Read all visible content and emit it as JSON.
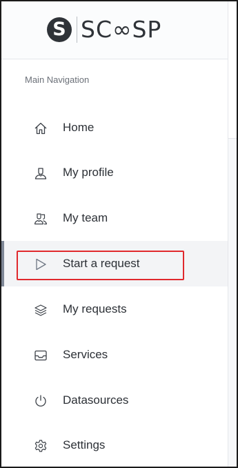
{
  "logo": {
    "mark": "S",
    "text": "SC∞SP"
  },
  "nav": {
    "section_label": "Main Navigation",
    "items": [
      {
        "label": "Home",
        "icon": "home-icon"
      },
      {
        "label": "My profile",
        "icon": "user-icon"
      },
      {
        "label": "My team",
        "icon": "users-icon"
      },
      {
        "label": "Start a request",
        "icon": "play-icon",
        "active": true
      },
      {
        "label": "My requests",
        "icon": "layers-icon"
      },
      {
        "label": "Services",
        "icon": "inbox-icon"
      },
      {
        "label": "Datasources",
        "icon": "power-icon"
      },
      {
        "label": "Settings",
        "icon": "gear-icon"
      }
    ]
  },
  "colors": {
    "highlight": "#e0282c",
    "active_bg": "#f3f4f6",
    "active_bar": "#7e8796",
    "text": "#2c3036",
    "muted": "#6b7078"
  }
}
